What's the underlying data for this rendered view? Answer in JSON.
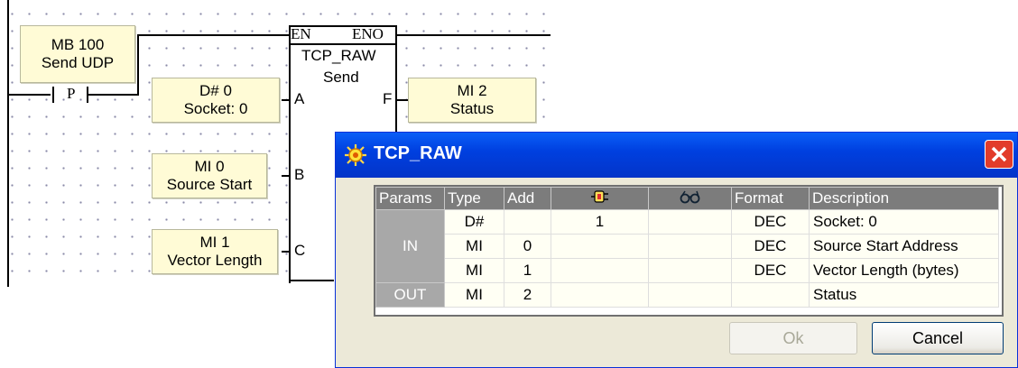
{
  "ladder": {
    "mb_box": {
      "line1": "MB 100",
      "line2": "Send UDP"
    },
    "contact": {
      "label": "P"
    },
    "socket_box": {
      "line1": "D# 0",
      "line2": "Socket: 0"
    },
    "source_box": {
      "line1": "MI 0",
      "line2": "Source Start"
    },
    "length_box": {
      "line1": "MI 1",
      "line2": "Vector Length"
    },
    "status_box": {
      "line1": "MI 2",
      "line2": "Status"
    },
    "function_block": {
      "en": "EN",
      "eno": "ENO",
      "name": "TCP_RAW",
      "op": "Send",
      "pin_a": "A",
      "pin_b": "B",
      "pin_c": "C",
      "pin_f": "F"
    }
  },
  "dialog": {
    "title": "TCP_RAW",
    "columns": [
      "Params",
      "Type",
      "Add",
      "",
      "",
      "Format",
      "Description"
    ],
    "column_icons": [
      "plug-icon",
      "glasses-icon"
    ],
    "groups": [
      {
        "label": "IN",
        "rows": [
          {
            "type": "D#",
            "add": "",
            "value": "1",
            "watch": "",
            "format": "DEC",
            "description": "Socket: 0"
          },
          {
            "type": "MI",
            "add": "0",
            "value": "",
            "watch": "",
            "format": "DEC",
            "description": "Source Start Address"
          },
          {
            "type": "MI",
            "add": "1",
            "value": "",
            "watch": "",
            "format": "DEC",
            "description": "Vector Length (bytes)"
          }
        ]
      },
      {
        "label": "OUT",
        "rows": [
          {
            "type": "MI",
            "add": "2",
            "value": "",
            "watch": "",
            "format": "",
            "description": "Status"
          }
        ]
      }
    ],
    "ok_label": "Ok",
    "cancel_label": "Cancel"
  },
  "colors": {
    "title_bar": "#0a5ff7",
    "operand_fill": "#fffbd6",
    "close_button": "#e23c2a"
  }
}
